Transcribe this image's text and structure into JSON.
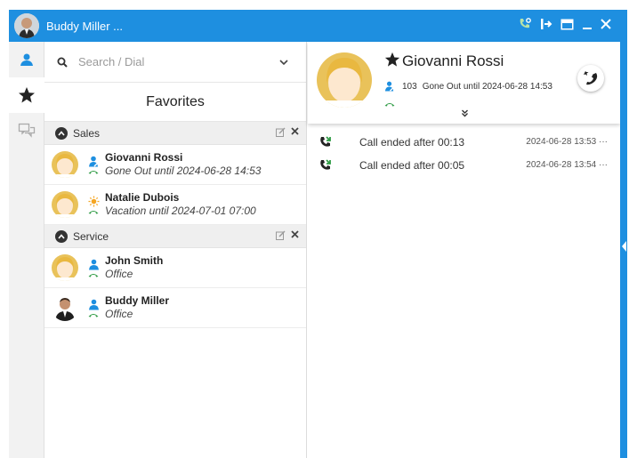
{
  "window": {
    "title": "Buddy Miller ..."
  },
  "search": {
    "placeholder": "Search / Dial"
  },
  "favorites": {
    "title": "Favorites",
    "groups": [
      {
        "name": "Sales",
        "contacts": [
          {
            "name": "Giovanni Rossi",
            "status": "Gone Out until 2024-06-28 14:53",
            "presence_icon": "person-away-icon"
          },
          {
            "name": "Natalie Dubois",
            "status": "Vacation until 2024-07-01 07:00",
            "presence_icon": "sun-icon"
          }
        ]
      },
      {
        "name": "Service",
        "contacts": [
          {
            "name": "John Smith",
            "status": "Office",
            "presence_icon": "person-icon"
          },
          {
            "name": "Buddy Miller",
            "status": "Office",
            "presence_icon": "person-icon"
          }
        ]
      }
    ]
  },
  "detail": {
    "name": "Giovanni Rossi",
    "extension": "103",
    "status": "Gone Out until 2024-06-28 14:53",
    "calls": [
      {
        "text": "Call ended after 00:13",
        "time": "2024-06-28 13:53 ···"
      },
      {
        "text": "Call ended after 00:05",
        "time": "2024-06-28 13:54 ···"
      }
    ]
  },
  "colors": {
    "accent": "#1e8fe0",
    "phone_green": "#2e9b44",
    "presence_blue": "#1e8fe0",
    "sun_orange": "#f5a623"
  }
}
